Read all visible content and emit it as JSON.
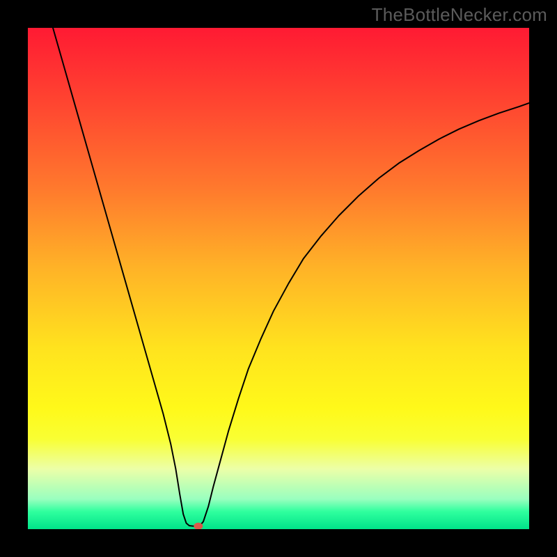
{
  "watermark": "TheBottleNecker.com",
  "chart_data": {
    "type": "line",
    "title": "",
    "xlabel": "",
    "ylabel": "",
    "xlim": [
      0,
      100
    ],
    "ylim": [
      0,
      100
    ],
    "grid": false,
    "legend": false,
    "background_gradient": {
      "stops": [
        {
          "offset": 0.0,
          "color": "#ff1a33"
        },
        {
          "offset": 0.16,
          "color": "#ff4830"
        },
        {
          "offset": 0.32,
          "color": "#ff792d"
        },
        {
          "offset": 0.48,
          "color": "#ffb327"
        },
        {
          "offset": 0.64,
          "color": "#ffe31e"
        },
        {
          "offset": 0.76,
          "color": "#fff91a"
        },
        {
          "offset": 0.82,
          "color": "#f9ff33"
        },
        {
          "offset": 0.88,
          "color": "#ecffa8"
        },
        {
          "offset": 0.94,
          "color": "#99ffbf"
        },
        {
          "offset": 0.965,
          "color": "#2fff9e"
        },
        {
          "offset": 1.0,
          "color": "#00e389"
        }
      ]
    },
    "curve": {
      "color": "#000000",
      "width": 2,
      "points": [
        [
          5.0,
          100.0
        ],
        [
          7.0,
          93.0
        ],
        [
          9.0,
          86.0
        ],
        [
          11.0,
          79.0
        ],
        [
          13.0,
          72.0
        ],
        [
          15.0,
          65.0
        ],
        [
          17.0,
          58.0
        ],
        [
          19.0,
          51.0
        ],
        [
          21.0,
          44.0
        ],
        [
          23.0,
          37.0
        ],
        [
          25.0,
          30.0
        ],
        [
          27.0,
          23.0
        ],
        [
          28.5,
          17.0
        ],
        [
          29.5,
          12.0
        ],
        [
          30.3,
          7.0
        ],
        [
          31.0,
          3.0
        ],
        [
          31.6,
          1.2
        ],
        [
          32.2,
          0.7
        ],
        [
          33.0,
          0.6
        ],
        [
          33.8,
          0.6
        ],
        [
          34.4,
          0.8
        ],
        [
          35.0,
          1.5
        ],
        [
          36.0,
          4.5
        ],
        [
          37.0,
          8.5
        ],
        [
          38.5,
          14.0
        ],
        [
          40.0,
          19.5
        ],
        [
          42.0,
          26.0
        ],
        [
          44.0,
          32.0
        ],
        [
          46.5,
          38.0
        ],
        [
          49.0,
          43.5
        ],
        [
          52.0,
          49.0
        ],
        [
          55.0,
          54.0
        ],
        [
          58.5,
          58.5
        ],
        [
          62.0,
          62.5
        ],
        [
          66.0,
          66.5
        ],
        [
          70.0,
          70.0
        ],
        [
          74.0,
          73.0
        ],
        [
          78.0,
          75.5
        ],
        [
          82.0,
          77.8
        ],
        [
          86.0,
          79.8
        ],
        [
          90.0,
          81.5
        ],
        [
          94.0,
          83.0
        ],
        [
          98.0,
          84.3
        ],
        [
          100.0,
          85.0
        ]
      ]
    },
    "marker": {
      "x": 34.0,
      "y": 0.6,
      "rx": 0.9,
      "ry": 0.7,
      "color": "#d9594a"
    }
  }
}
